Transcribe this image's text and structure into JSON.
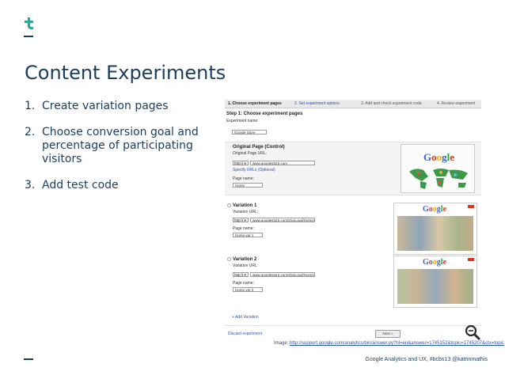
{
  "logo": {
    "glyph": "t"
  },
  "title": "Content Experiments",
  "steps": [
    {
      "num": "1.",
      "text": "Create variation pages"
    },
    {
      "num": "2.",
      "text": "Choose conversion goal and percentage of participating visitors"
    },
    {
      "num": "3.",
      "text": "Add test code"
    }
  ],
  "screenshot": {
    "wizard": {
      "step1": "1. Choose experiment pages",
      "step2": "2. Set experiment options",
      "step3": "3. Add and check experiment code",
      "step4": "4. Review experiment"
    },
    "heading": "Step 1: Choose experiment pages",
    "experiment_name_label": "Experiment name:",
    "experiment_name_value": "Google Store",
    "original": {
      "heading": "Original Page (Control)",
      "url_label": "Original Page URL:",
      "protocol": "http://",
      "url_value": "www.googlestore.com",
      "specify_link": "Specify URLs (Optional)",
      "page_name_label": "Page name:",
      "page_name_value": "Home"
    },
    "variation1": {
      "heading": "Variation 1",
      "url_label": "Variation URL:",
      "protocol": "http://",
      "url_value": "www.googlestore.com/shop.axd/Home1",
      "page_name_label": "Page name:",
      "page_name_value": "Home var 1"
    },
    "variation2": {
      "heading": "Variation 2",
      "url_label": "Variation URL:",
      "protocol": "http://",
      "url_value": "www.googlestore.com/shop.axd/Home2",
      "page_name_label": "Page name:",
      "page_name_value": "Home var 2"
    },
    "add_variation": "+ Add Variation",
    "discard": "Discard experiment",
    "next": "Next »",
    "google_word": [
      "G",
      "o",
      "o",
      "g",
      "l",
      "e"
    ]
  },
  "credit": {
    "prefix": "Image: ",
    "link": "http://support.google.com/analytics/bin/answer.py?hl=en&answer=1745152&topic=1745207&ctx=topic"
  },
  "footer": "Google Analytics and UX, #bcbs13 @katrinmathis",
  "colors": {
    "primary": "#1a3d5f",
    "accent": "#2a56b0",
    "logo_accent": "#29a8a0"
  },
  "icons": {
    "zoom": "magnifier-icon",
    "logo": "brand-logo-icon"
  }
}
